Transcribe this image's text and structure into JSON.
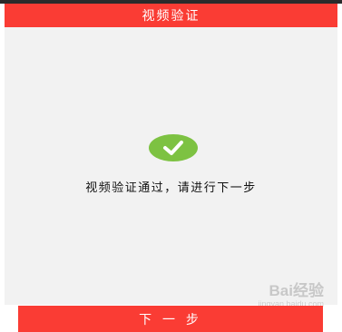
{
  "header": {
    "title": "视频验证"
  },
  "main": {
    "message": "视频验证通过，请进行下一步",
    "status_icon": "check-circle-icon"
  },
  "footer": {
    "next_label": "下 一 步"
  },
  "watermark": {
    "brand": "Bai经验",
    "url": "jingyan.baidu.com"
  },
  "colors": {
    "accent": "#fa3c34",
    "success": "#7dc242",
    "background": "#f2f2f2"
  }
}
